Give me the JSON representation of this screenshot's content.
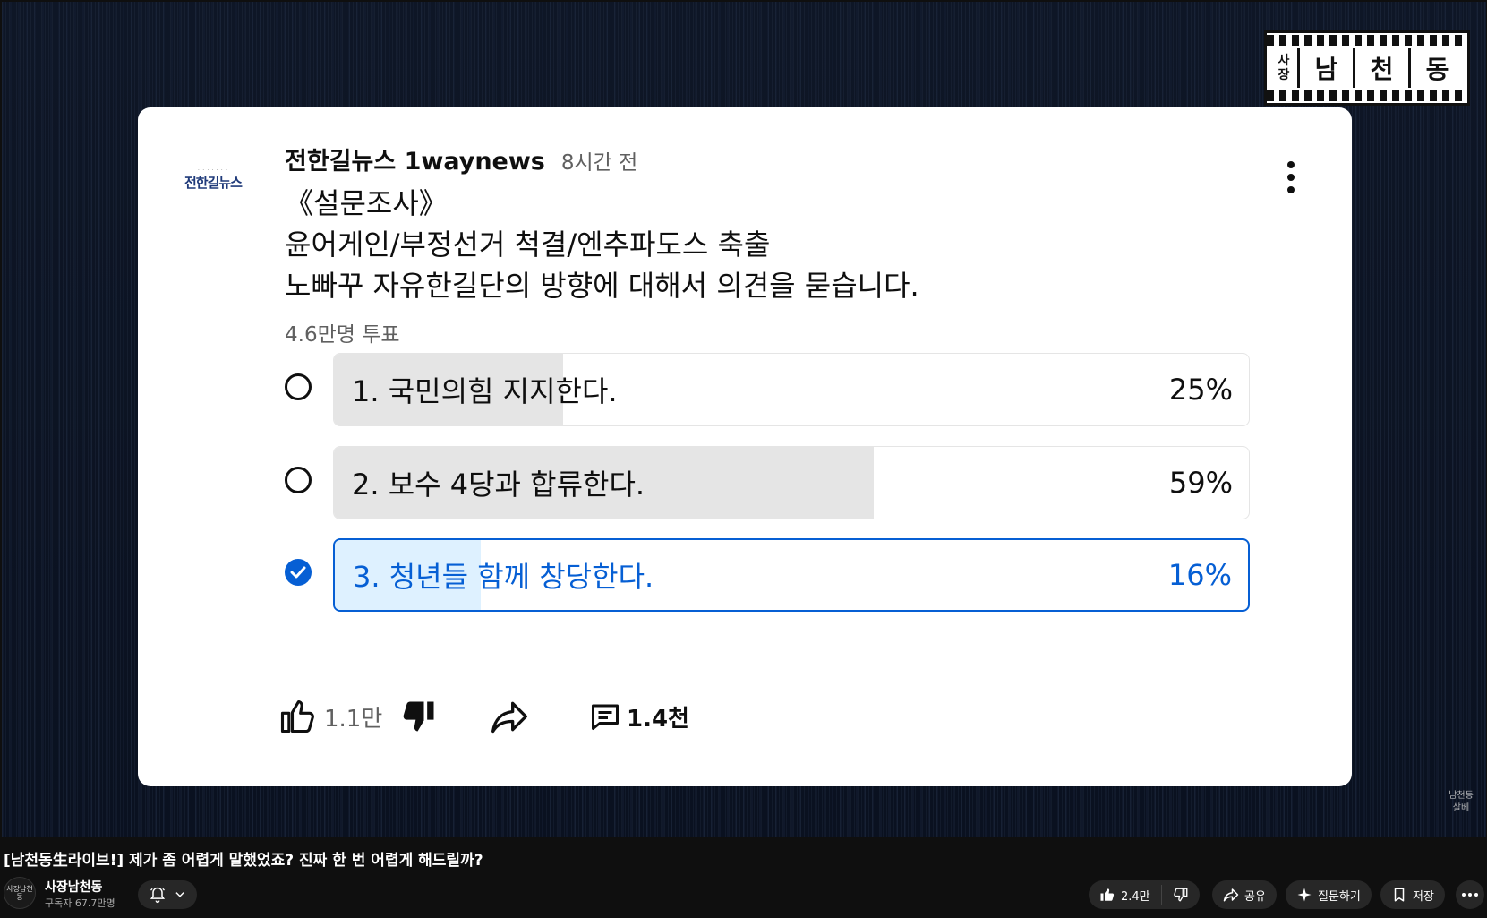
{
  "video": {
    "channel_logo": {
      "small": [
        "사",
        "장"
      ],
      "chars": [
        "남",
        "천",
        "동"
      ]
    },
    "corner_mark": [
      "남천동",
      "살베"
    ]
  },
  "post": {
    "avatar_text": "전한길뉴스",
    "author": "전한길뉴스 1waynews",
    "time": "8시간 전",
    "body_lines": [
      "《설문조사》",
      "윤어게인/부정선거 척결/엔추파도스 축출",
      "노빠꾸 자유한길단의 방향에 대해서 의견을 묻습니다."
    ],
    "vote_count": "4.6만명 투표",
    "options": [
      {
        "label": "1. 국민의힘 지지한다.",
        "percent": "25%",
        "fraction": 0.25,
        "selected": false
      },
      {
        "label": "2. 보수 4당과 합류한다.",
        "percent": "59%",
        "fraction": 0.59,
        "selected": false
      },
      {
        "label": "3. 청년들 함께 창당한다.",
        "percent": "16%",
        "fraction": 0.16,
        "selected": true
      }
    ],
    "actions": {
      "likes": "1.1만",
      "comments": "1.4천"
    }
  },
  "below": {
    "title": "[남천동生라이브!] 제가 좀 어렵게 말했었죠? 진짜 한 번 어렵게 해드릴까?",
    "channel_name": "사장남천동",
    "subscribers": "구독자 67.7만명",
    "avatar_text": "사장남천동",
    "likes": "2.4만",
    "share_label": "공유",
    "ask_label": "질문하기",
    "save_label": "저장"
  },
  "colors": {
    "accent": "#065fd4",
    "selected_fill": "#def1ff",
    "bar_fill": "#e5e5e5"
  }
}
